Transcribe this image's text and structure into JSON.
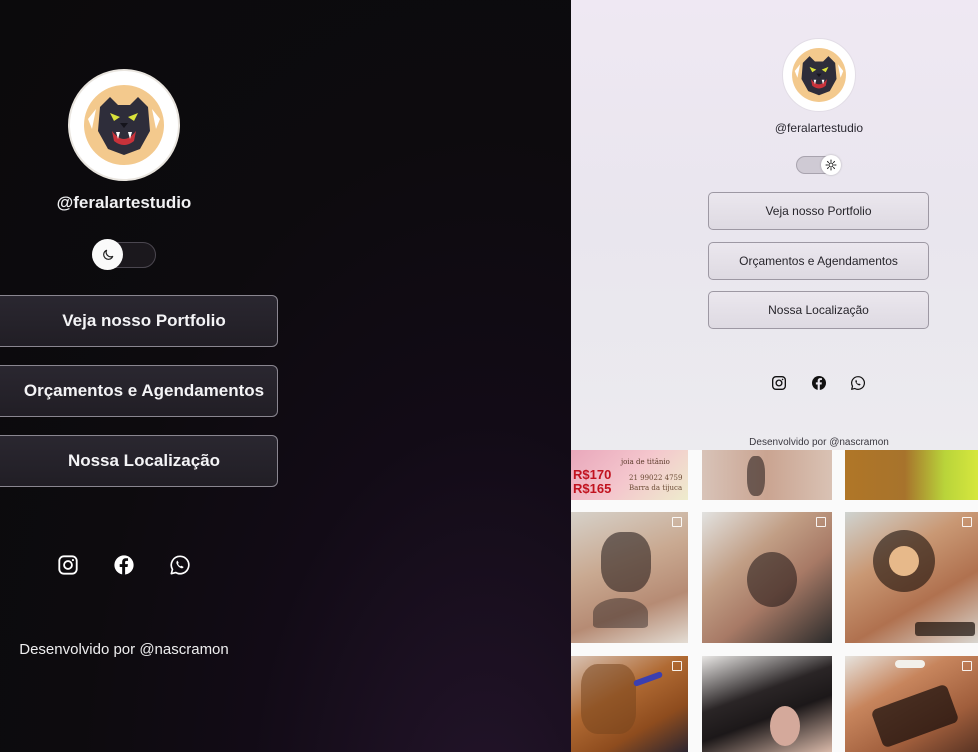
{
  "dark_panel": {
    "handle": "@feralartestudio",
    "theme_toggle": {
      "state": "dark",
      "icon": "moon-icon"
    },
    "buttons": [
      "Veja nosso Portfolio",
      "Orçamentos e Agendamentos",
      "Nossa Localização"
    ],
    "social": [
      "instagram-icon",
      "facebook-icon",
      "whatsapp-icon"
    ],
    "footer": "Desenvolvido por @nascramon"
  },
  "light_panel": {
    "handle": "@feralartestudio",
    "theme_toggle": {
      "state": "light",
      "icon": "sun-icon"
    },
    "buttons": [
      "Veja nosso Portfolio",
      "Orçamentos e Agendamentos",
      "Nossa Localização"
    ],
    "social": [
      "instagram-icon",
      "facebook-icon",
      "whatsapp-icon"
    ],
    "footer": "Desenvolvido por @nascramon"
  },
  "grid": {
    "tile1": {
      "price_1": "R$170",
      "price_2": "R$165",
      "text_1": "joia de titânio",
      "text_2": "21 99022 4759",
      "text_3": "Barra da tijuca"
    }
  },
  "colors": {
    "dark_bg": "#0b0a0c",
    "dark_button": "#242128",
    "light_bg": "#ece9f0",
    "light_button": "#e3dfe7",
    "price_red": "#c1121f"
  }
}
